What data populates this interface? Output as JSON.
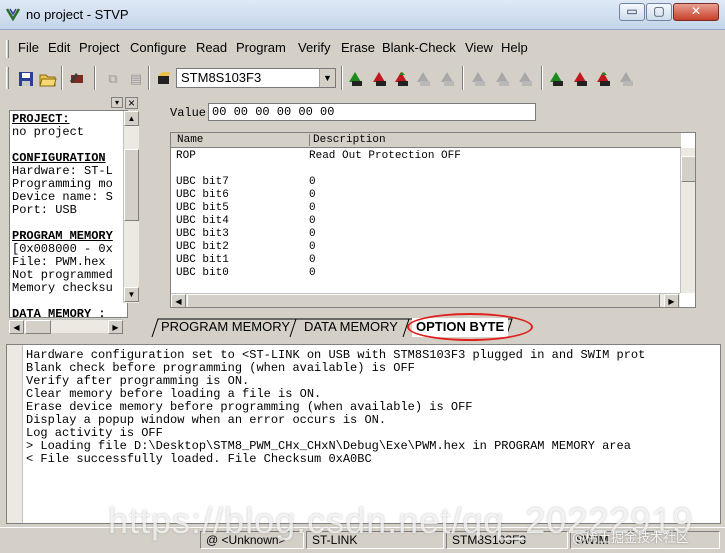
{
  "window": {
    "title": "no project - STVP",
    "minimize_glyph": "▭",
    "maximize_glyph": "▢",
    "close_glyph": "✕"
  },
  "menu": {
    "items": [
      "File",
      "Edit",
      "Project",
      "Configure",
      "Read",
      "Program",
      "Verify",
      "Erase",
      "Blank-Check",
      "View",
      "Help"
    ]
  },
  "toolbar": {
    "device": "STM8S103F3",
    "colors": {
      "program_red": "#c0181c",
      "program_green": "#1c8a1c",
      "disabled": "#9a9a9a"
    }
  },
  "workspace": {
    "close_glyph": "×",
    "lines": [
      {
        "text": "PROJECT:",
        "heading": true
      },
      {
        "text": "no project",
        "heading": false
      },
      {
        "text": "",
        "heading": false
      },
      {
        "text": "CONFIGURATION",
        "heading": true
      },
      {
        "text": "Hardware: ST-L",
        "heading": false
      },
      {
        "text": "Programming mo",
        "heading": false
      },
      {
        "text": "Device name: S",
        "heading": false
      },
      {
        "text": "Port: USB",
        "heading": false
      },
      {
        "text": "",
        "heading": false
      },
      {
        "text": "PROGRAM MEMORY",
        "heading": true
      },
      {
        "text": "[0x008000 - 0x",
        "heading": false
      },
      {
        "text": "File: PWM.hex",
        "heading": false
      },
      {
        "text": "Not programmed",
        "heading": false
      },
      {
        "text": "Memory checksu",
        "heading": false
      },
      {
        "text": "",
        "heading": false
      },
      {
        "text": "DATA MEMORY :",
        "heading": true
      }
    ]
  },
  "option_byte": {
    "value_label": "Value",
    "value": "00 00 00 00 00 00",
    "columns": [
      "Name",
      "Description"
    ],
    "rows": [
      {
        "name": "ROP",
        "description": "Read Out Protection OFF"
      },
      {
        "name": "",
        "description": ""
      },
      {
        "name": "UBC bit7",
        "description": "0"
      },
      {
        "name": "UBC bit6",
        "description": "0"
      },
      {
        "name": "UBC bit5",
        "description": "0"
      },
      {
        "name": "UBC bit4",
        "description": "0"
      },
      {
        "name": "UBC bit3",
        "description": "0"
      },
      {
        "name": "UBC bit2",
        "description": "0"
      },
      {
        "name": "UBC bit1",
        "description": "0"
      },
      {
        "name": "UBC bit0",
        "description": "0"
      }
    ]
  },
  "tabs": [
    "PROGRAM MEMORY",
    "DATA MEMORY",
    "OPTION BYTE"
  ],
  "active_tab": "OPTION BYTE",
  "log": {
    "lines": [
      "Hardware configuration set to <ST-LINK on USB with STM8S103F3 plugged in and SWIM prot",
      "Blank check before programming (when available) is OFF",
      "Verify after programming is ON.",
      "Clear memory before loading a file is ON.",
      "Erase device memory before programming (when available) is OFF",
      "Display a popup window when an error occurs is ON.",
      "Log activity is OFF",
      "> Loading file D:\\Desktop\\STM8_PWM_CHx_CHxN\\Debug\\Exe\\PWM.hex in PROGRAM MEMORY area",
      "< File successfully loaded. File Checksum 0xA0BC"
    ]
  },
  "statusbar": {
    "cells": [
      "@ <Unknown>",
      "ST-LINK",
      "STM8S103F3",
      "SWIM"
    ]
  },
  "watermark": {
    "text": "https://blog.csdn.net/qq_20222919",
    "secondary": "@稀土掘金技术社区"
  }
}
